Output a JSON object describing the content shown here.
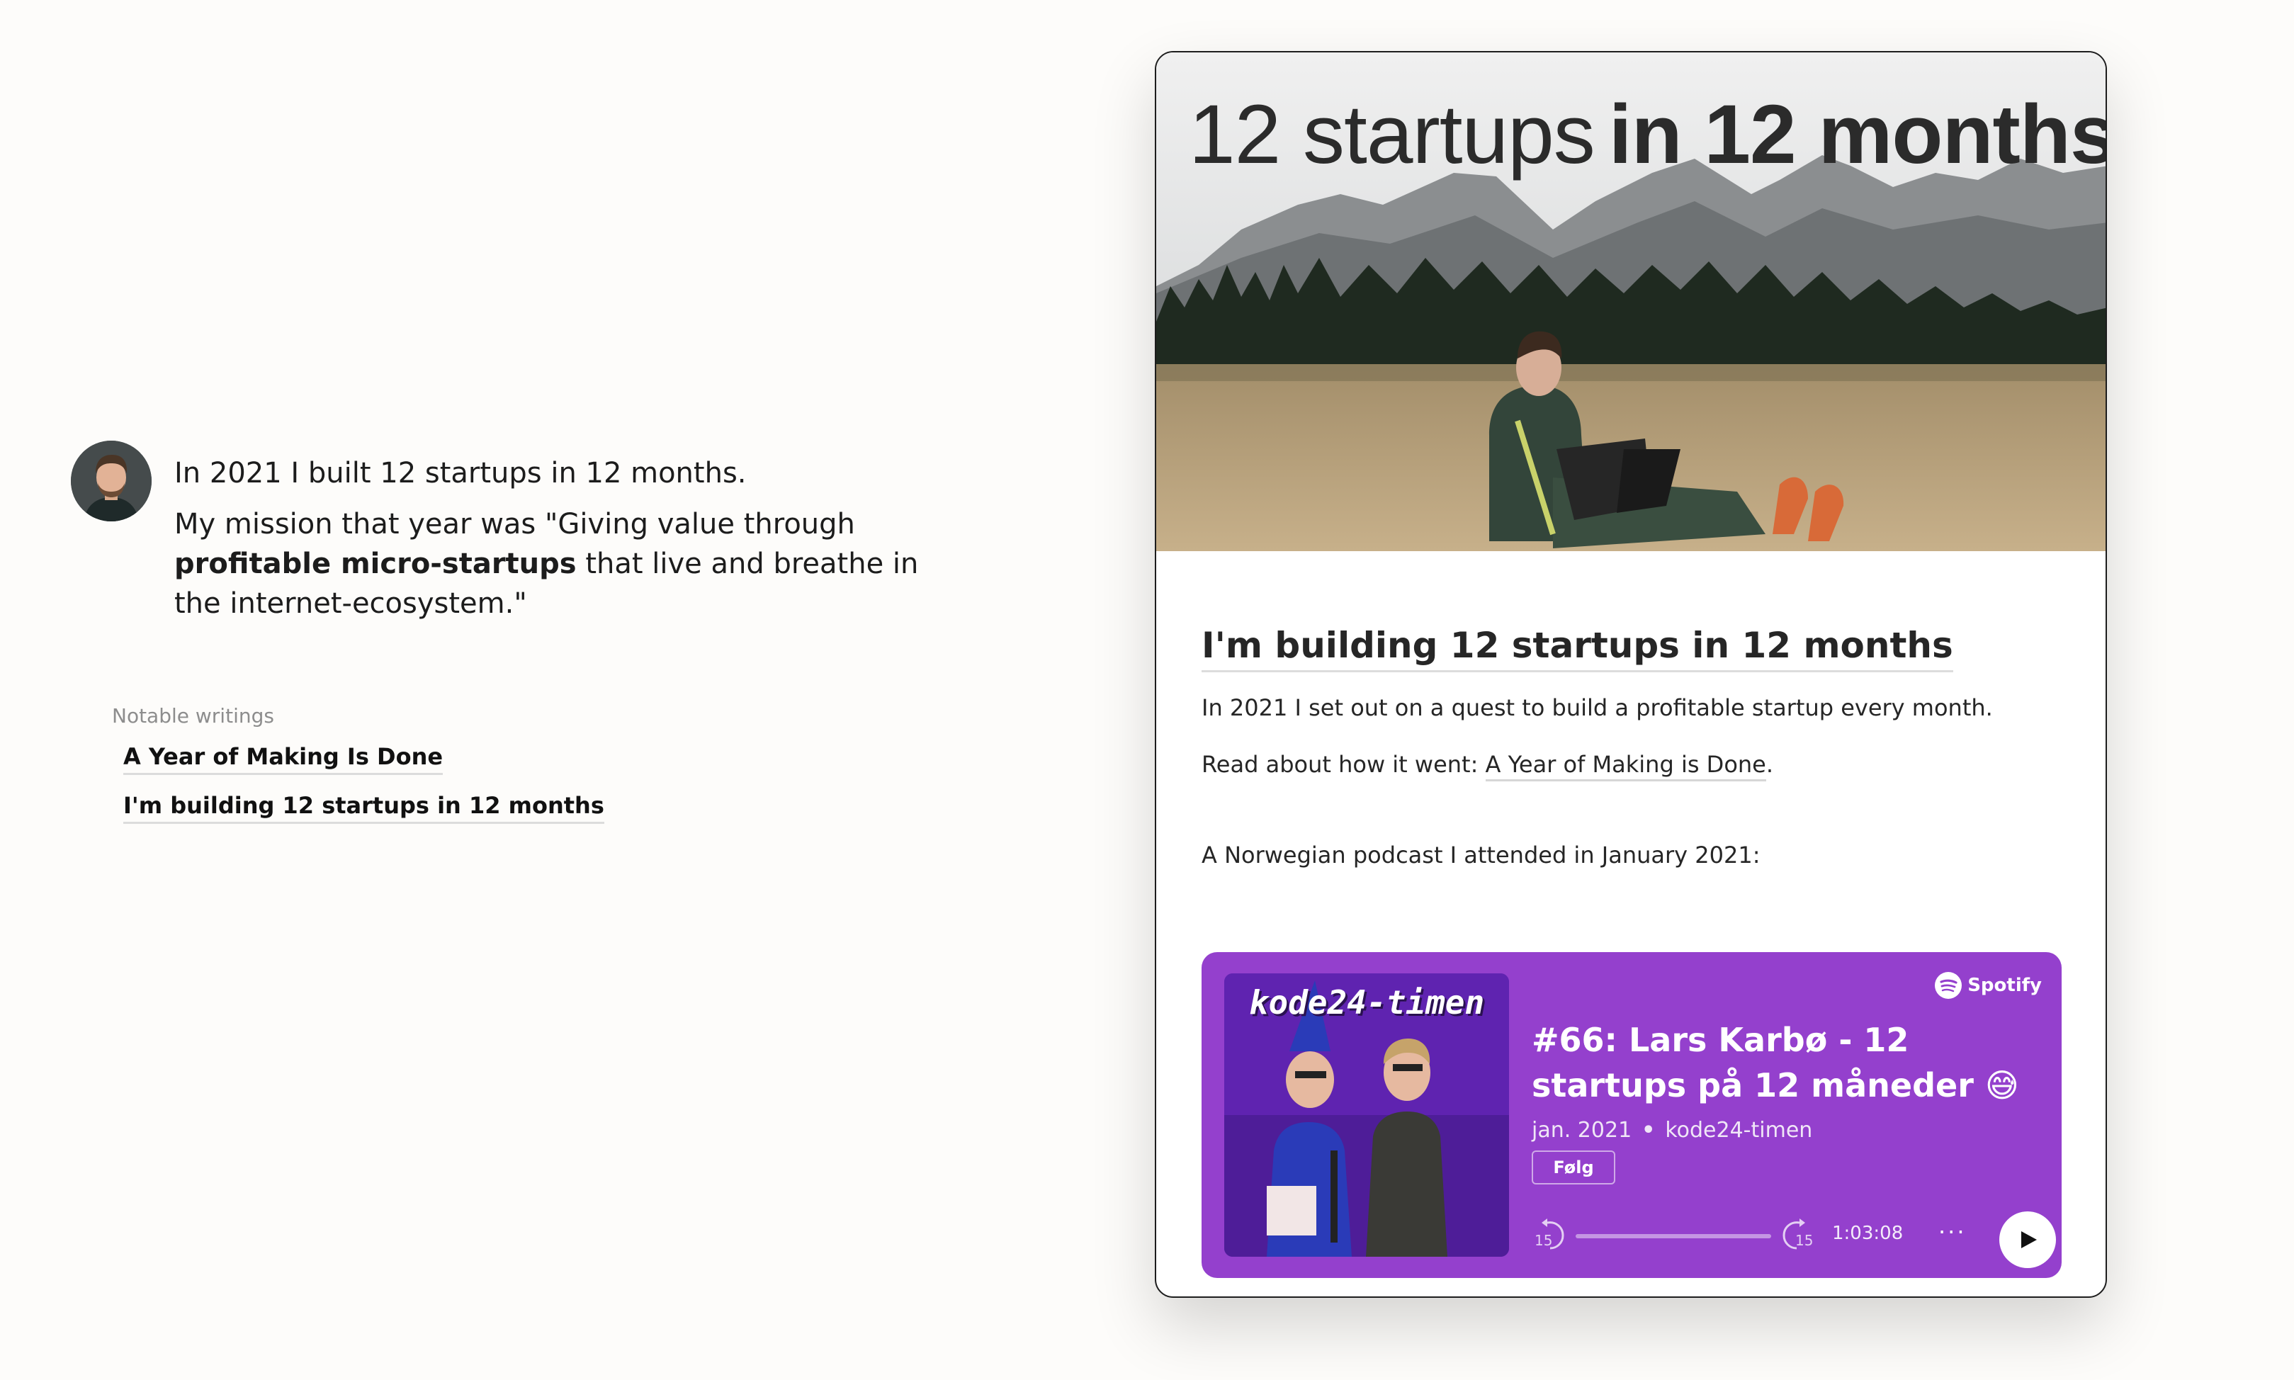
{
  "intro": {
    "line1": "In 2021 I built 12 startups in 12 months.",
    "mission_prefix": "My mission that year was \"Giving value through ",
    "mission_bold": "profitable micro-startups",
    "mission_suffix": " that live and breathe in the internet-ecosystem.\""
  },
  "notable": {
    "label": "Notable writings",
    "items": [
      {
        "label": "A Year of Making Is Done"
      },
      {
        "label": "I'm building 12 startups in 12 months"
      }
    ]
  },
  "card": {
    "hero_light": "12 startups",
    "hero_bold": "in 12 months",
    "heading": "I'm building 12 startups in 12 months",
    "p1": "In 2021 I set out on a quest to build a profitable startup every month.",
    "p2_prefix": "Read about how it went: ",
    "p2_link": "A Year of Making is Done",
    "p2_suffix": ".",
    "p3": "A Norwegian podcast I attended in January 2021:"
  },
  "spotify": {
    "brand": "Spotify",
    "cover_title": "kode24-timen",
    "episode_title": "#66: Lars Karbø - 12 startups på 12 måneder 😅",
    "date": "jan. 2021",
    "show": "kode24-timen",
    "follow_label": "Følg",
    "skip_back_label": "15",
    "skip_fwd_label": "15",
    "duration": "1:03:08",
    "more_label": "···",
    "progress": 0.0,
    "accent": "#9440cd"
  }
}
